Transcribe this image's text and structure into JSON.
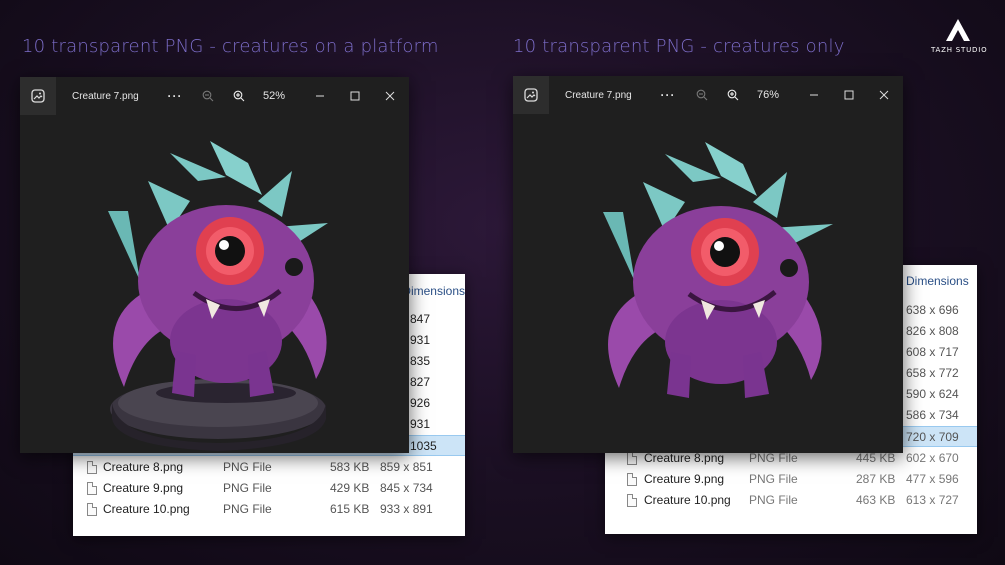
{
  "headings": {
    "left": "10 transparent PNG - creatures on a platform",
    "right": "10 transparent PNG - creatures only"
  },
  "brand": {
    "name": "TAZH STUDIO",
    "logo_icon": "triangle-a-logo-icon"
  },
  "left_panel": {
    "viewer": {
      "filename": "Creature 7.png",
      "zoom": "52%",
      "more_label": "···"
    },
    "explorer": {
      "dimensions_header": "Dimensions",
      "partial_dims": [
        "847",
        "931",
        "835",
        "827",
        "926",
        "931",
        "1035"
      ],
      "rows": [
        {
          "name": "Creature 8.png",
          "type": "PNG File",
          "size": "583 KB",
          "dims": "859 x 851"
        },
        {
          "name": "Creature 9.png",
          "type": "PNG File",
          "size": "429 KB",
          "dims": "845 x 734"
        },
        {
          "name": "Creature 10.png",
          "type": "PNG File",
          "size": "615 KB",
          "dims": "933 x 891"
        }
      ]
    }
  },
  "right_panel": {
    "viewer": {
      "filename": "Creature 7.png",
      "zoom": "76%",
      "more_label": "···"
    },
    "explorer": {
      "dimensions_header": "Dimensions",
      "partial_dims": [
        "638 x 696",
        "826 x 808",
        "608 x 717",
        "658 x 772",
        "590 x 624",
        "586 x 734",
        "720 x 709"
      ],
      "rows": [
        {
          "name": "Creature 8.png",
          "type": "PNG File",
          "size": "445 KB",
          "dims": "602 x 670"
        },
        {
          "name": "Creature 9.png",
          "type": "PNG File",
          "size": "287 KB",
          "dims": "477 x 596"
        },
        {
          "name": "Creature 10.png",
          "type": "PNG File",
          "size": "463 KB",
          "dims": "613 x 727"
        }
      ]
    }
  },
  "colors": {
    "heading": "#7b6cc7",
    "viewer_bg": "#1f1f1f",
    "selection": "#cce4f7",
    "creature_body": "#8a3f9a",
    "creature_spikes": "#7cc8c4",
    "creature_eye": "#e04050"
  }
}
